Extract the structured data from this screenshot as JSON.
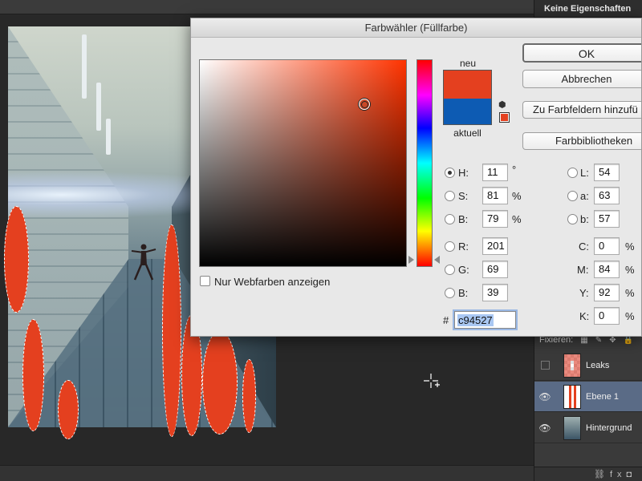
{
  "app": {
    "panel_title": "Keine Eigenschaften"
  },
  "dialog": {
    "title": "Farbwähler (Füllfarbe)",
    "new_label": "neu",
    "current_label": "aktuell",
    "new_color": "#e4401f",
    "current_color": "#0d5bb3",
    "buttons": {
      "ok": "OK",
      "cancel": "Abbrechen",
      "add_to_swatches": "Zu Farbfeldern hinzufü",
      "color_libraries": "Farbbibliotheken"
    },
    "web_only": {
      "label": "Nur Webfarben anzeigen",
      "checked": false
    },
    "fields": {
      "H": {
        "label": "H:",
        "value": "11",
        "unit": "°",
        "selected": true
      },
      "S": {
        "label": "S:",
        "value": "81",
        "unit": "%"
      },
      "Bri": {
        "label": "B:",
        "value": "79",
        "unit": "%"
      },
      "R": {
        "label": "R:",
        "value": "201"
      },
      "G": {
        "label": "G:",
        "value": "69"
      },
      "Blue": {
        "label": "B:",
        "value": "39"
      },
      "L": {
        "label": "L:",
        "value": "54"
      },
      "a": {
        "label": "a:",
        "value": "63"
      },
      "b": {
        "label": "b:",
        "value": "57"
      },
      "C": {
        "label": "C:",
        "value": "0",
        "unit": "%"
      },
      "M": {
        "label": "M:",
        "value": "84",
        "unit": "%"
      },
      "Y": {
        "label": "Y:",
        "value": "92",
        "unit": "%"
      },
      "K": {
        "label": "K:",
        "value": "0",
        "unit": "%"
      }
    },
    "hex_label": "#",
    "hex_value": "c94527"
  },
  "layers": {
    "lock_label": "Fixieren:",
    "items": [
      {
        "name": "Leaks",
        "visible": false
      },
      {
        "name": "Ebene 1",
        "visible": true,
        "selected": true
      },
      {
        "name": "Hintergrund",
        "visible": true
      }
    ],
    "footer_icons": [
      "link-icon",
      "fx-icon",
      "mask-icon"
    ]
  },
  "colors": {
    "selection_fill": "#e4401f",
    "panel_bg": "#3a3a3a",
    "selected_layer": "#5a6b86"
  }
}
